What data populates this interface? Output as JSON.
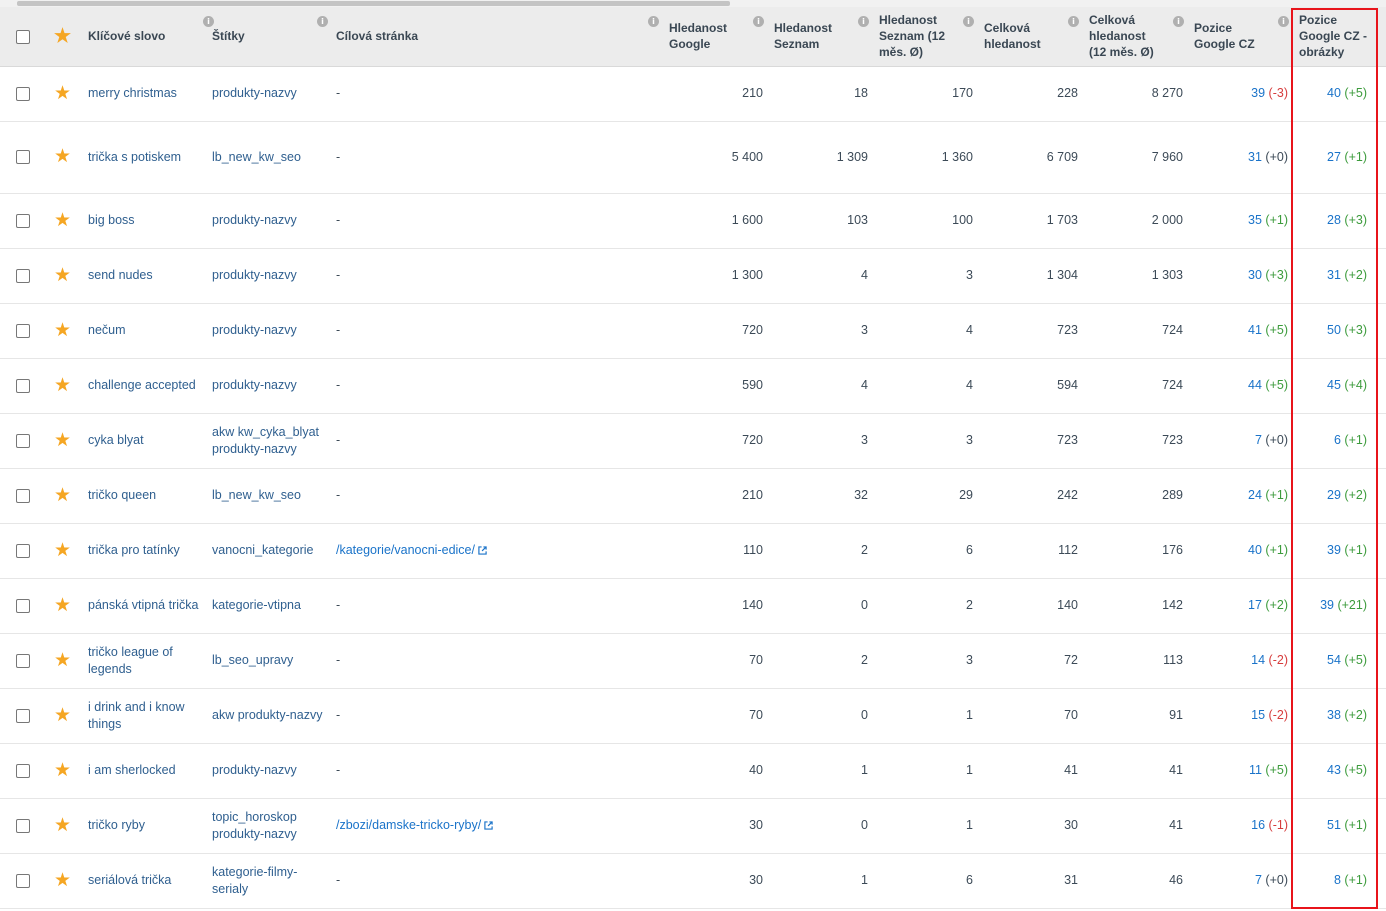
{
  "columns": {
    "keyword": "Klíčové slovo",
    "tags": "Štítky",
    "target_page": "Cílová stránka",
    "search_google": "Hledanost Google",
    "search_seznam": "Hledanost Seznam",
    "search_seznam_12m": "Hledanost Seznam (12 měs. Ø)",
    "search_total": "Celková hledanost",
    "search_total_12m": "Celková hledanost (12 měs. Ø)",
    "pos_google": "Pozice Google CZ",
    "pos_google_images": "Pozice Google CZ - obrázky"
  },
  "info_icon_text": "i",
  "rows": [
    {
      "keyword": "merry christmas",
      "tags": [
        "produkty-nazvy"
      ],
      "target": "-",
      "g": "210",
      "s": "18",
      "s12": "170",
      "t": "228",
      "t12": "8 270",
      "pg": "39",
      "pgd": "(-3)",
      "pgdir": "down",
      "pi": "40",
      "pid": "(+5)",
      "pidir": "up"
    },
    {
      "keyword": "trička s potiskem",
      "tags": [
        "lb_new_kw_seo"
      ],
      "target": "-",
      "g": "5 400",
      "s": "1 309",
      "s12": "1 360",
      "t": "6 709",
      "t12": "7 960",
      "pg": "31",
      "pgd": "(+0)",
      "pgdir": "same",
      "pi": "27",
      "pid": "(+1)",
      "pidir": "up"
    },
    {
      "keyword": "big boss",
      "tags": [
        "produkty-nazvy"
      ],
      "target": "-",
      "g": "1 600",
      "s": "103",
      "s12": "100",
      "t": "1 703",
      "t12": "2 000",
      "pg": "35",
      "pgd": "(+1)",
      "pgdir": "up",
      "pi": "28",
      "pid": "(+3)",
      "pidir": "up"
    },
    {
      "keyword": "send nudes",
      "tags": [
        "produkty-nazvy"
      ],
      "target": "-",
      "g": "1 300",
      "s": "4",
      "s12": "3",
      "t": "1 304",
      "t12": "1 303",
      "pg": "30",
      "pgd": "(+3)",
      "pgdir": "up",
      "pi": "31",
      "pid": "(+2)",
      "pidir": "up"
    },
    {
      "keyword": "nečum",
      "tags": [
        "produkty-nazvy"
      ],
      "target": "-",
      "g": "720",
      "s": "3",
      "s12": "4",
      "t": "723",
      "t12": "724",
      "pg": "41",
      "pgd": "(+5)",
      "pgdir": "up",
      "pi": "50",
      "pid": "(+3)",
      "pidir": "up"
    },
    {
      "keyword": "challenge accepted",
      "tags": [
        "produkty-nazvy"
      ],
      "target": "-",
      "g": "590",
      "s": "4",
      "s12": "4",
      "t": "594",
      "t12": "724",
      "pg": "44",
      "pgd": "(+5)",
      "pgdir": "up",
      "pi": "45",
      "pid": "(+4)",
      "pidir": "up"
    },
    {
      "keyword": "cyka blyat",
      "tags": [
        "akw kw_cyka_blyat",
        "produkty-nazvy"
      ],
      "target": "-",
      "g": "720",
      "s": "3",
      "s12": "3",
      "t": "723",
      "t12": "723",
      "pg": "7",
      "pgd": "(+0)",
      "pgdir": "same",
      "pi": "6",
      "pid": "(+1)",
      "pidir": "up"
    },
    {
      "keyword": "tričko queen",
      "tags": [
        "lb_new_kw_seo"
      ],
      "target": "-",
      "g": "210",
      "s": "32",
      "s12": "29",
      "t": "242",
      "t12": "289",
      "pg": "24",
      "pgd": "(+1)",
      "pgdir": "up",
      "pi": "29",
      "pid": "(+2)",
      "pidir": "up"
    },
    {
      "keyword": "trička pro tatínky",
      "tags": [
        "vanocni_kategorie"
      ],
      "target": "/kategorie/vanocni-edice/",
      "g": "110",
      "s": "2",
      "s12": "6",
      "t": "112",
      "t12": "176",
      "pg": "40",
      "pgd": "(+1)",
      "pgdir": "up",
      "pi": "39",
      "pid": "(+1)",
      "pidir": "up"
    },
    {
      "keyword": "pánská vtipná trička",
      "tags": [
        "kategorie-vtipna"
      ],
      "target": "-",
      "g": "140",
      "s": "0",
      "s12": "2",
      "t": "140",
      "t12": "142",
      "pg": "17",
      "pgd": "(+2)",
      "pgdir": "up",
      "pi": "39",
      "pid": "(+21)",
      "pidir": "up"
    },
    {
      "keyword": "tričko league of legends",
      "tags": [
        "lb_seo_upravy"
      ],
      "target": "-",
      "g": "70",
      "s": "2",
      "s12": "3",
      "t": "72",
      "t12": "113",
      "pg": "14",
      "pgd": "(-2)",
      "pgdir": "down",
      "pi": "54",
      "pid": "(+5)",
      "pidir": "up"
    },
    {
      "keyword": "i drink and i know things",
      "tags": [
        "akw produkty-nazvy"
      ],
      "target": "-",
      "g": "70",
      "s": "0",
      "s12": "1",
      "t": "70",
      "t12": "91",
      "pg": "15",
      "pgd": "(-2)",
      "pgdir": "down",
      "pi": "38",
      "pid": "(+2)",
      "pidir": "up"
    },
    {
      "keyword": "i am sherlocked",
      "tags": [
        "produkty-nazvy"
      ],
      "target": "-",
      "g": "40",
      "s": "1",
      "s12": "1",
      "t": "41",
      "t12": "41",
      "pg": "11",
      "pgd": "(+5)",
      "pgdir": "up",
      "pi": "43",
      "pid": "(+5)",
      "pidir": "up"
    },
    {
      "keyword": "tričko ryby",
      "tags": [
        "topic_horoskop",
        "produkty-nazvy"
      ],
      "target": "/zbozi/damske-tricko-ryby/",
      "g": "30",
      "s": "0",
      "s12": "1",
      "t": "30",
      "t12": "41",
      "pg": "16",
      "pgd": "(-1)",
      "pgdir": "down",
      "pi": "51",
      "pid": "(+1)",
      "pidir": "up"
    },
    {
      "keyword": "seriálová trička",
      "tags": [
        "kategorie-filmy-serialy"
      ],
      "target": "-",
      "g": "30",
      "s": "1",
      "s12": "6",
      "t": "31",
      "t12": "46",
      "pg": "7",
      "pgd": "(+0)",
      "pgdir": "same",
      "pi": "8",
      "pid": "(+1)",
      "pidir": "up"
    }
  ],
  "colors": {
    "accent_link": "#1a73c9",
    "up": "#3c9b3c",
    "down": "#d63c3c",
    "star": "#f5a623",
    "highlight": "#e8141b"
  }
}
